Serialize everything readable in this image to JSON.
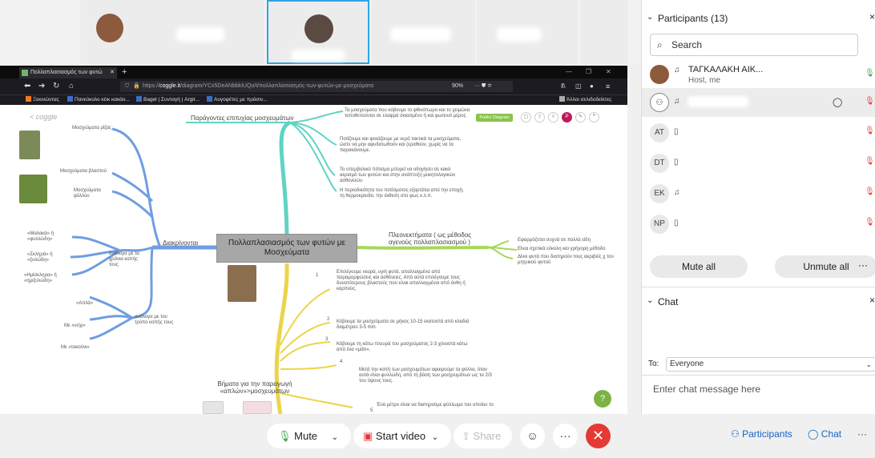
{
  "browser": {
    "tab_title": "Πολλαπλασιασμός των φυτώ",
    "tab_close": "✕",
    "new_tab": "+",
    "url_prefix": "https://",
    "url_domain": "coggle.it",
    "url_rest": "/diagram/YCx5DeANbbkiUQo/t/πολλαπλασιασμός-των-φυτών-με-μοσχεύματα",
    "zoom": "90%",
    "bookmarks": [
      "Ξεκινώντας",
      "Πανεύκολο κέικ κακάο...",
      "Bagel | Συνταγή | Argir...",
      "Αυγοφέτες με πράσιν..."
    ],
    "other_bookmarks": "Άλλοι σελιδοδείκτες"
  },
  "mindmap": {
    "logo": "< coggle",
    "public_badge": "Public Diagram",
    "central": "Πολλαπλασιασμός των φυτών με Μοσχεύματα",
    "success_factors": "Παράγοντες επιτυχίας μοσχευμάτων",
    "factors": [
      "Τα μοσχεύματα που κόβουμε το φθινόπωρο και το χειμώνα τοποθετούνται σε ελαφρά σκιασμένο ή και φωτεινό μέρος",
      "Ποτίζουμε και ψεκάζουμε με νερό τακτικά τα μοσχεύματα, ώστε να μην αφυδατωθούν και (εραθούν, χωρίς να τα παρακάνουμε.",
      "Το υπερβολικό πότισμα μπορεί να οδηγήσει σε κακό αερισμό των φυτών και στην ανάπτυξη μυκητολογικών ασθενειών.",
      "Η περιοδικότητα του ποτίσματος εξαρτάται από την εποχή, τη θερμοκρασία, την έκθεση στο φως κ.λ.π."
    ],
    "advantages": "Πλεονεκτήματα ( ως μέθοδος αγενούς πολλαπλασιασμού )",
    "adv_items": [
      "Εφαρμόζεται συχνά σε πολλά είδη",
      "Είναι σχετικά εύκολη και γρήγορη μέθοδο",
      "Δίνει φυτά που διατηρούν τους ακριβείς χ του μητρικού φυτού"
    ],
    "distinguish": "Διακρίνονται",
    "cutting_types": [
      "Μοσχεύματα ρίζας",
      "Μοσχεύματα βλαστού",
      "Μοσχεύματα φύλλου"
    ],
    "by_age": "ανάλογα με τα χρόνια κοπής τους",
    "age_items": [
      "«Μαλακά» ή «φυλλώδη»",
      "«Σκληρά» ή «ξυλώδη»",
      "«Ημίσκληρα» ή «ημιξυλώδη»"
    ],
    "by_method": "ανάλογα με τον τρόπο κοπής τους",
    "method_items": [
      "«Απλά»",
      "Με «νύχι»",
      "Με «τακούνι»"
    ],
    "steps_title": "Βήματα για την παραγωγή «απλών»>μοσχευμάτων",
    "step_numbers": [
      "1",
      "2",
      "3",
      "4",
      "5"
    ],
    "steps": [
      "Επιλέγουμε νεαρά, υγιή φυτά, απαλλαγμένα από παραμορφώσεις και ασθένειες. Από αυτά επιλέγουμε τους δυνατότερους βλαστούς που είναι απαλλαγμένοι από άνθη ή καρπούς.",
      "Κόβουμε τα μοσχεύματα σε μήκος 10-15 εκατοστά από κλαδιά διαμέτρου 3-5 mm.",
      "Κόβουμε τη κάτω πλευρά του μοσχεύματος 2-3 χιλιοστά κάτω από ένα «μάτι».",
      "Μετά την κοπή των μοσχευμάτων αφαιρούμε τα φύλλα, όταν αυτά είναι φυλλώδη, από τη βάση των μοσχευμάτων ως τα 2/3 του ύψους τους.",
      "Ένα μέτρο είναι να διατηρούμε φύλλωμα του οποίου το"
    ],
    "help": "?"
  },
  "toolbar": {
    "mute": "Mute",
    "start_video": "Start video",
    "share": "Share",
    "emoji": "☺",
    "more": "···",
    "end": "✕",
    "participants": "Participants",
    "chat": "Chat",
    "more_right": "···"
  },
  "participants": {
    "header": "Participants (13)",
    "close": "×",
    "search_placeholder": "Search",
    "host_name": "ΤΑΓΚΑΛΑΚΗ ΑΙΚ...",
    "host_role": "Host, me",
    "rows": [
      {
        "initials": "AT"
      },
      {
        "initials": "DT"
      },
      {
        "initials": "EK"
      },
      {
        "initials": "NP"
      }
    ],
    "mute_all": "Mute all",
    "unmute_all": "Unmute all",
    "more": "···"
  },
  "chat": {
    "header": "Chat",
    "close": "×",
    "to_label": "To:",
    "to_value": "Everyone",
    "placeholder": "Enter chat message here"
  },
  "colors": {
    "teal": "#5fd3c4",
    "green": "#a6d85a",
    "yellow": "#ecd44a",
    "blue": "#6f9ee0",
    "end_red": "#e53935",
    "accent_blue": "#2fa4e7"
  }
}
